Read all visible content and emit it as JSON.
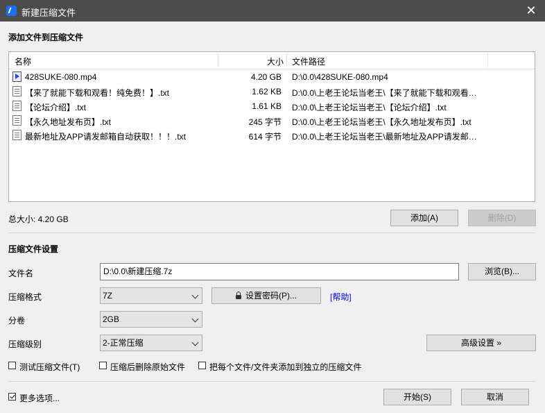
{
  "window": {
    "title": "新建压缩文件",
    "close_glyph": "✕"
  },
  "add_section": {
    "title": "添加文件到压缩文件"
  },
  "file_list": {
    "columns": {
      "name": "名称",
      "size": "大小",
      "path": "文件路径"
    },
    "rows": [
      {
        "name": "428SUKE-080.mp4",
        "size": "4.20 GB",
        "path": "D:\\0.0\\428SUKE-080.mp4",
        "icon": "video-file-icon"
      },
      {
        "name": "【来了就能下载和观看！纯免费！】.txt",
        "size": "1.62 KB",
        "path": "D:\\0.0\\上老王论坛当老王\\【来了就能下载和观看…",
        "icon": "text-file-icon"
      },
      {
        "name": "【论坛介绍】.txt",
        "size": "1.61 KB",
        "path": "D:\\0.0\\上老王论坛当老王\\【论坛介绍】.txt",
        "icon": "text-file-icon"
      },
      {
        "name": "【永久地址发布页】.txt",
        "size": "245 字节",
        "path": "D:\\0.0\\上老王论坛当老王\\【永久地址发布页】.txt",
        "icon": "text-file-icon"
      },
      {
        "name": "最新地址及APP请发邮箱自动获取！！！.txt",
        "size": "614 字节",
        "path": "D:\\0.0\\上老王论坛当老王\\最新地址及APP请发邮…",
        "icon": "text-file-icon"
      }
    ]
  },
  "total_size": "总大小: 4.20 GB",
  "buttons": {
    "add": "添加(A)",
    "delete": "删除(D)",
    "browse": "浏览(B)...",
    "set_password": "设置密码(P)...",
    "advanced": "高级设置 »",
    "start": "开始(S)",
    "cancel": "取消"
  },
  "settings": {
    "title": "压缩文件设置",
    "filename_label": "文件名",
    "filename_value": "D:\\0.0\\新建压缩.7z",
    "format_label": "压缩格式",
    "format_value": "7Z",
    "split_label": "分卷",
    "split_value": "2GB",
    "level_label": "压缩级别",
    "level_value": "2-正常压缩",
    "help_link": "[帮助]"
  },
  "options": {
    "test": {
      "label": "测试压缩文件(T)",
      "checked": false
    },
    "delete_after": {
      "label": "压缩后删除原始文件",
      "checked": false
    },
    "separate": {
      "label": "把每个文件/文件夹添加到独立的压缩文件",
      "checked": false
    },
    "more": {
      "label": "更多选项...",
      "checked": true
    }
  }
}
